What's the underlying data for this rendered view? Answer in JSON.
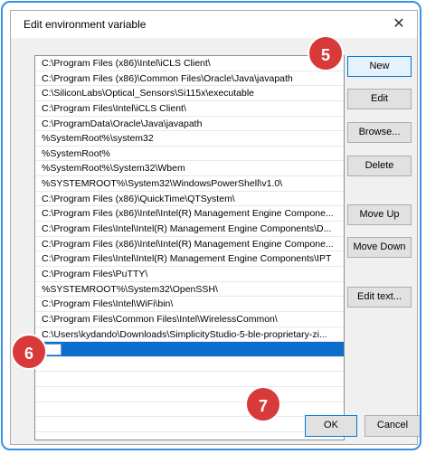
{
  "window": {
    "title": "Edit environment variable",
    "close_glyph": "✕"
  },
  "paths": [
    "C:\\Program Files (x86)\\Intel\\iCLS Client\\",
    "C:\\Program Files (x86)\\Common Files\\Oracle\\Java\\javapath",
    "C:\\SiliconLabs\\Optical_Sensors\\Si115x\\executable",
    "C:\\Program Files\\Intel\\iCLS Client\\",
    "C:\\ProgramData\\Oracle\\Java\\javapath",
    "%SystemRoot%\\system32",
    "%SystemRoot%",
    "%SystemRoot%\\System32\\Wbem",
    "%SYSTEMROOT%\\System32\\WindowsPowerShell\\v1.0\\",
    "C:\\Program Files (x86)\\QuickTime\\QTSystem\\",
    "C:\\Program Files (x86)\\Intel\\Intel(R) Management Engine Compone...",
    "C:\\Program Files\\Intel\\Intel(R) Management Engine Components\\D...",
    "C:\\Program Files (x86)\\Intel\\Intel(R) Management Engine Compone...",
    "C:\\Program Files\\Intel\\Intel(R) Management Engine Components\\IPT",
    "C:\\Program Files\\PuTTY\\",
    "%SYSTEMROOT%\\System32\\OpenSSH\\",
    "C:\\Program Files\\Intel\\WiFi\\bin\\",
    "C:\\Program Files\\Common Files\\Intel\\WirelessCommon\\",
    "C:\\Users\\kydando\\Downloads\\SimplicityStudio-5-ble-proprietary-zi..."
  ],
  "buttons": {
    "new": "New",
    "edit": "Edit",
    "browse": "Browse...",
    "delete": "Delete",
    "move_up": "Move Up",
    "move_down": "Move Down",
    "edit_text": "Edit text...",
    "ok": "OK",
    "cancel": "Cancel"
  },
  "callouts": {
    "step5": "5",
    "step6": "6",
    "step7": "7"
  },
  "colors": {
    "accent": "#0078d7",
    "selection": "#0b6dcc",
    "callout": "#d83a3a"
  }
}
